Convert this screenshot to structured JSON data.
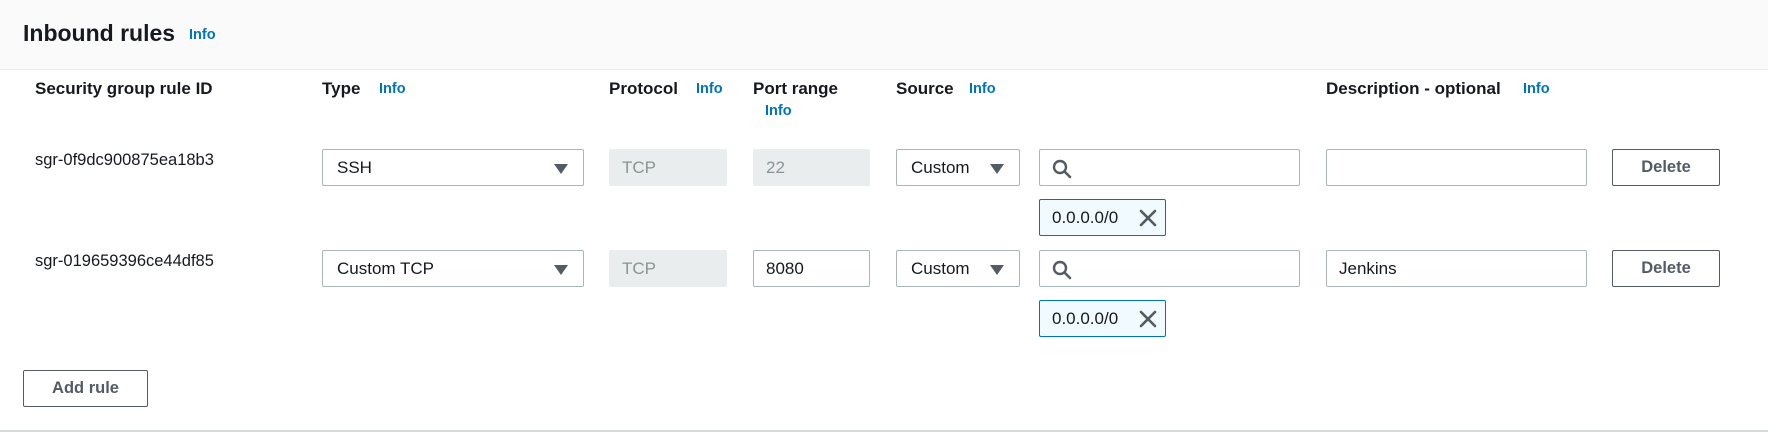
{
  "panel": {
    "title": "Inbound rules",
    "info": "Info"
  },
  "columns": {
    "rule_id": "Security group rule ID",
    "type": "Type",
    "type_info": "Info",
    "protocol": "Protocol",
    "protocol_info": "Info",
    "port_range": "Port range",
    "port_range_info": "Info",
    "source": "Source",
    "source_info": "Info",
    "description": "Description - optional",
    "description_info": "Info"
  },
  "rules": [
    {
      "id": "sgr-0f9dc900875ea18b3",
      "type": "SSH",
      "protocol": "TCP",
      "port_range": "22",
      "source_type": "Custom",
      "source_search": "",
      "source_token": "0.0.0.0/0",
      "description": "",
      "delete_label": "Delete"
    },
    {
      "id": "sgr-019659396ce44df85",
      "type": "Custom TCP",
      "protocol": "TCP",
      "port_range": "8080",
      "source_type": "Custom",
      "source_search": "",
      "source_token": "0.0.0.0/0",
      "description": "Jenkins",
      "delete_label": "Delete"
    }
  ],
  "actions": {
    "add_rule": "Add rule"
  },
  "colors": {
    "link": "#0073bb",
    "token_border": "#0073bb",
    "token_bg": "#f1faff",
    "disabled_bg": "#eaeded"
  },
  "icons": {
    "caret": "caret-down-icon",
    "search": "search-icon",
    "close": "close-icon"
  }
}
